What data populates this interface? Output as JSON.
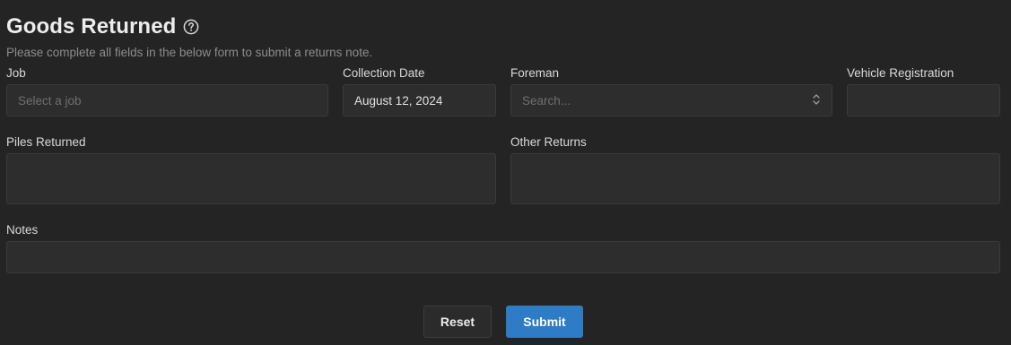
{
  "header": {
    "title": "Goods Returned",
    "subtitle": "Please complete all fields in the below form to submit a returns note."
  },
  "fields": {
    "job": {
      "label": "Job",
      "placeholder": "Select a job",
      "value": ""
    },
    "collection_date": {
      "label": "Collection Date",
      "value": "August 12, 2024"
    },
    "foreman": {
      "label": "Foreman",
      "placeholder": "Search..."
    },
    "vehicle_registration": {
      "label": "Vehicle Registration",
      "value": ""
    },
    "piles_returned": {
      "label": "Piles Returned",
      "value": ""
    },
    "other_returns": {
      "label": "Other Returns",
      "value": ""
    },
    "notes": {
      "label": "Notes",
      "value": ""
    }
  },
  "actions": {
    "reset_label": "Reset",
    "submit_label": "Submit"
  },
  "colors": {
    "background": "#242424",
    "field_background": "#2d2d2d",
    "primary": "#2e7bc6"
  }
}
